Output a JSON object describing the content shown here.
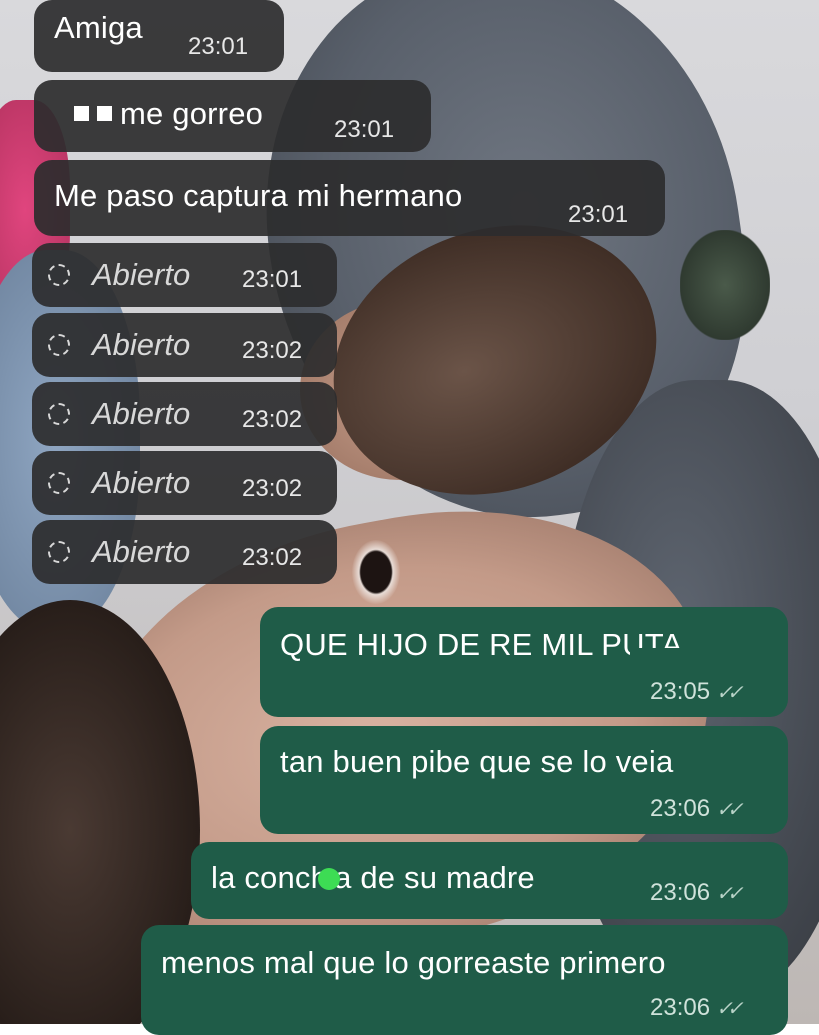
{
  "messages_in": [
    {
      "text": "Amiga",
      "time": "23:01"
    },
    {
      "text": "me gorreo",
      "time": "23:01"
    },
    {
      "text": "Me paso captura mi hermano",
      "time": "23:01"
    }
  ],
  "opened": [
    {
      "label": "Abierto",
      "time": "23:01"
    },
    {
      "label": "Abierto",
      "time": "23:02"
    },
    {
      "label": "Abierto",
      "time": "23:02"
    },
    {
      "label": "Abierto",
      "time": "23:02"
    },
    {
      "label": "Abierto",
      "time": "23:02"
    }
  ],
  "messages_out": [
    {
      "text": "QUE HIJO DE RE MIL PUTA",
      "time": "23:05"
    },
    {
      "text": "tan buen pibe que se lo veia",
      "time": "23:06"
    },
    {
      "text_before": "la conch",
      "text_after": "a de su madre",
      "time": "23:06"
    },
    {
      "text": "menos mal que lo gorreaste primero",
      "time": "23:06"
    }
  ],
  "colors": {
    "incoming": "#2c2c2e",
    "outgoing": "#1f5c48",
    "sticker_dot": "#3ddc54"
  },
  "icons": {
    "opened": "dashed-circle-icon",
    "read": "double-check-icon",
    "censor": "square-block-icon"
  }
}
